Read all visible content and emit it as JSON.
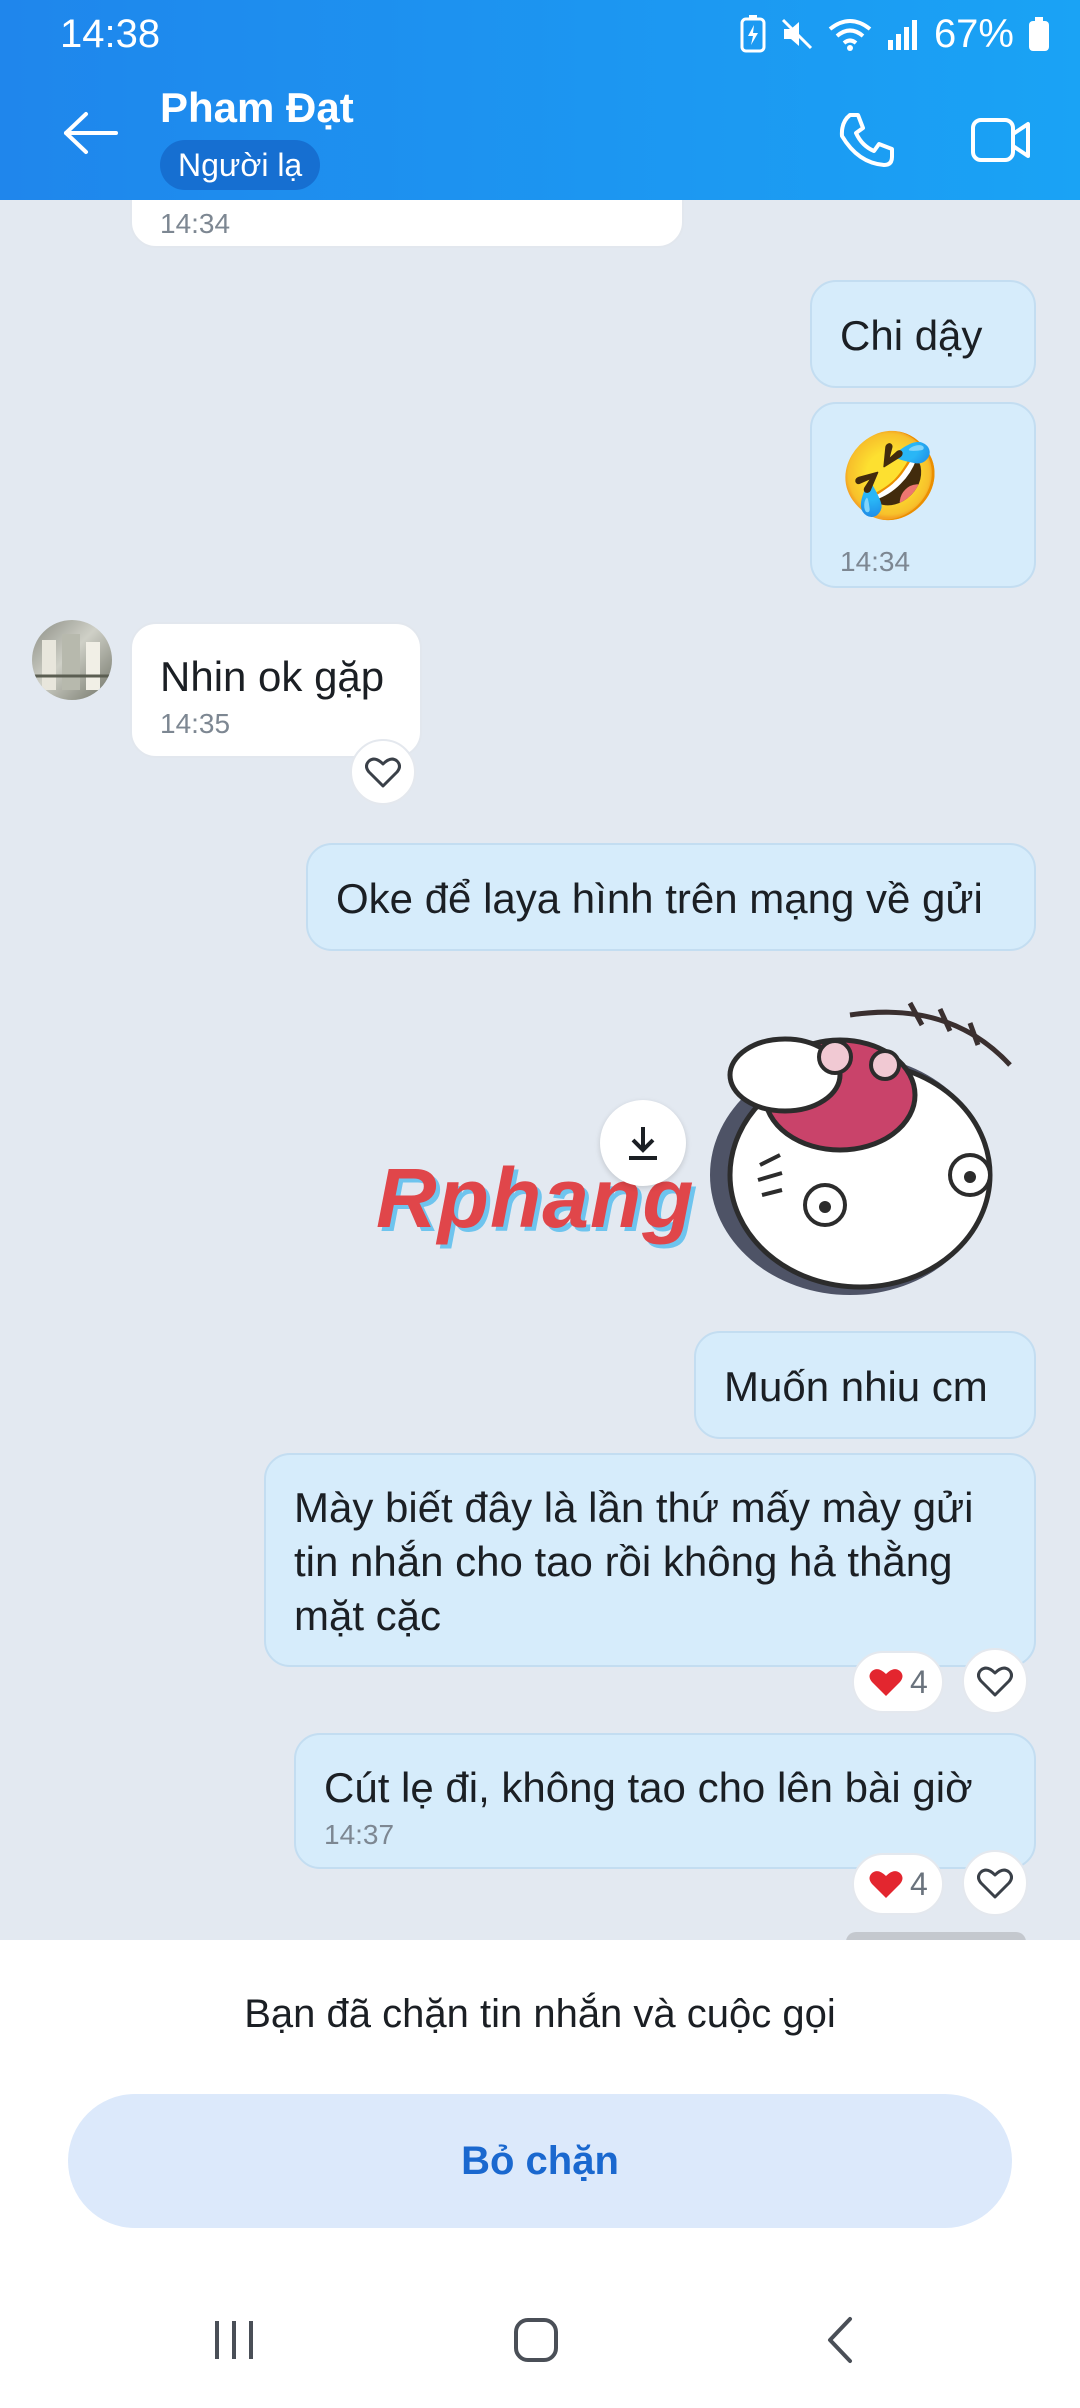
{
  "status_bar": {
    "time": "14:38",
    "battery": "67%"
  },
  "header": {
    "contact_name": "Pham Đạt",
    "badge": "Người lạ"
  },
  "messages": {
    "m0_time": "14:34",
    "m1_text": "Chi dậy",
    "m2_emoji": "🤣",
    "m2_time": "14:34",
    "m3_text": "Nhin ok gặp",
    "m3_time": "14:35",
    "m4_text": "Oke để laya hình trên mạng về gửi",
    "m6_text": "Muốn nhiu cm",
    "m7_text": "Mày biết đây là lần thứ mấy mày gửi tin nhắn cho tao rồi không hả thằng mặt cặc",
    "m7_reaction_count": "4",
    "m8_text": "Cút lẹ đi, không tao cho lên bài giờ",
    "m8_time": "14:37",
    "m8_reaction_count": "4"
  },
  "watermark": "Rphang",
  "blocked": {
    "notice": "Bạn đã chặn tin nhắn và cuộc gọi",
    "unblock_label": "Bỏ chặn"
  },
  "icons": [
    "back-arrow-icon",
    "phone-icon",
    "video-call-icon",
    "heart-icon",
    "download-icon",
    "recents-icon",
    "home-icon",
    "back-nav-icon"
  ],
  "colors": {
    "header_start": "#1f86ec",
    "header_end": "#1aa3f5",
    "out_bubble": "#d6ecfb",
    "in_bubble": "#ffffff",
    "chat_bg": "#e3e9f1",
    "accent": "#1a68cf"
  }
}
